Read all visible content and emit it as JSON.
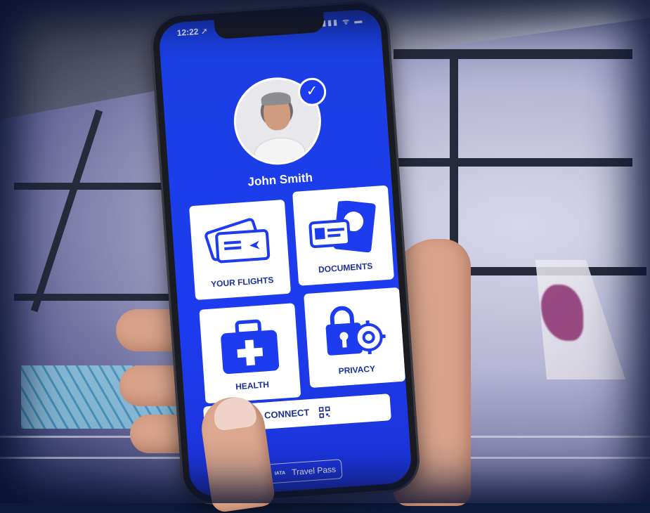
{
  "status_bar": {
    "time": "12:22 ➚",
    "icons": "▮▮▮ ᯤ ▬"
  },
  "profile": {
    "name": "John Smith"
  },
  "tiles": [
    {
      "label": "YOUR FLIGHTS",
      "icon": "boarding-pass-icon"
    },
    {
      "label": "DOCUMENTS",
      "icon": "passport-id-icon"
    },
    {
      "label": "HEALTH",
      "icon": "medical-kit-icon"
    },
    {
      "label": "PRIVACY",
      "icon": "lock-gear-icon"
    }
  ],
  "connect": {
    "label": "CONNECT",
    "icon": "qr-code-icon"
  },
  "branding": {
    "iata": "IATA",
    "product": "Travel Pass"
  },
  "colors": {
    "primary_blue": "#1d3cf0",
    "tile_bg": "#ffffff",
    "label_blue": "#1a2f9a"
  }
}
